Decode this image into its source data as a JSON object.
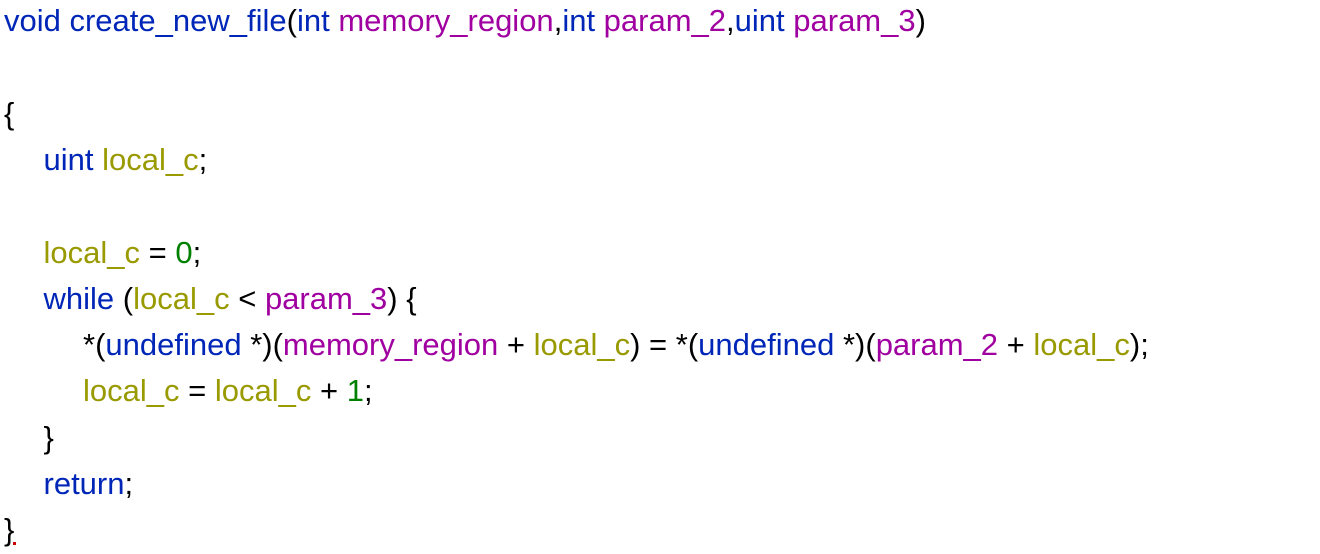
{
  "colors": {
    "keyword": "#0026b8",
    "parameter": "#a000a0",
    "local": "#999900",
    "number": "#008000",
    "plain": "#000000"
  },
  "lines": [
    {
      "indent": 0,
      "tokens": [
        {
          "text": "void ",
          "kind": "keyword"
        },
        {
          "text": "create_new_file",
          "kind": "keyword"
        },
        {
          "text": "(",
          "kind": "plain"
        },
        {
          "text": "int ",
          "kind": "keyword"
        },
        {
          "text": "memory_region",
          "kind": "parameter"
        },
        {
          "text": ",",
          "kind": "plain"
        },
        {
          "text": "int ",
          "kind": "keyword"
        },
        {
          "text": "param_2",
          "kind": "parameter"
        },
        {
          "text": ",",
          "kind": "plain"
        },
        {
          "text": "uint ",
          "kind": "keyword"
        },
        {
          "text": "param_3",
          "kind": "parameter"
        },
        {
          "text": ")",
          "kind": "plain"
        }
      ]
    },
    {
      "indent": 0,
      "tokens": []
    },
    {
      "indent": 0,
      "tokens": [
        {
          "text": "{",
          "kind": "plain"
        }
      ]
    },
    {
      "indent": 1,
      "tokens": [
        {
          "text": "uint ",
          "kind": "keyword"
        },
        {
          "text": "local_c",
          "kind": "local"
        },
        {
          "text": ";",
          "kind": "plain"
        }
      ]
    },
    {
      "indent": 0,
      "tokens": []
    },
    {
      "indent": 1,
      "tokens": [
        {
          "text": "local_c",
          "kind": "local"
        },
        {
          "text": " = ",
          "kind": "plain"
        },
        {
          "text": "0",
          "kind": "number"
        },
        {
          "text": ";",
          "kind": "plain"
        }
      ]
    },
    {
      "indent": 1,
      "tokens": [
        {
          "text": "while",
          "kind": "keyword"
        },
        {
          "text": " (",
          "kind": "plain"
        },
        {
          "text": "local_c",
          "kind": "local"
        },
        {
          "text": " < ",
          "kind": "plain"
        },
        {
          "text": "param_3",
          "kind": "parameter"
        },
        {
          "text": ") {",
          "kind": "plain"
        }
      ]
    },
    {
      "indent": 2,
      "tokens": [
        {
          "text": "*(",
          "kind": "plain"
        },
        {
          "text": "undefined",
          "kind": "keyword"
        },
        {
          "text": " *)(",
          "kind": "plain"
        },
        {
          "text": "memory_region",
          "kind": "parameter"
        },
        {
          "text": " + ",
          "kind": "plain"
        },
        {
          "text": "local_c",
          "kind": "local"
        },
        {
          "text": ") = *(",
          "kind": "plain"
        },
        {
          "text": "undefined",
          "kind": "keyword"
        },
        {
          "text": " *)(",
          "kind": "plain"
        },
        {
          "text": "param_2",
          "kind": "parameter"
        },
        {
          "text": " + ",
          "kind": "plain"
        },
        {
          "text": "local_c",
          "kind": "local"
        },
        {
          "text": ");",
          "kind": "plain"
        }
      ]
    },
    {
      "indent": 2,
      "tokens": [
        {
          "text": "local_c",
          "kind": "local"
        },
        {
          "text": " = ",
          "kind": "plain"
        },
        {
          "text": "local_c",
          "kind": "local"
        },
        {
          "text": " + ",
          "kind": "plain"
        },
        {
          "text": "1",
          "kind": "number"
        },
        {
          "text": ";",
          "kind": "plain"
        }
      ]
    },
    {
      "indent": 1,
      "tokens": [
        {
          "text": "}",
          "kind": "plain"
        }
      ]
    },
    {
      "indent": 1,
      "tokens": [
        {
          "text": "return",
          "kind": "keyword"
        },
        {
          "text": ";",
          "kind": "plain"
        }
      ]
    },
    {
      "indent": 0,
      "tokens": [
        {
          "text": "}",
          "kind": "plain"
        }
      ]
    }
  ]
}
